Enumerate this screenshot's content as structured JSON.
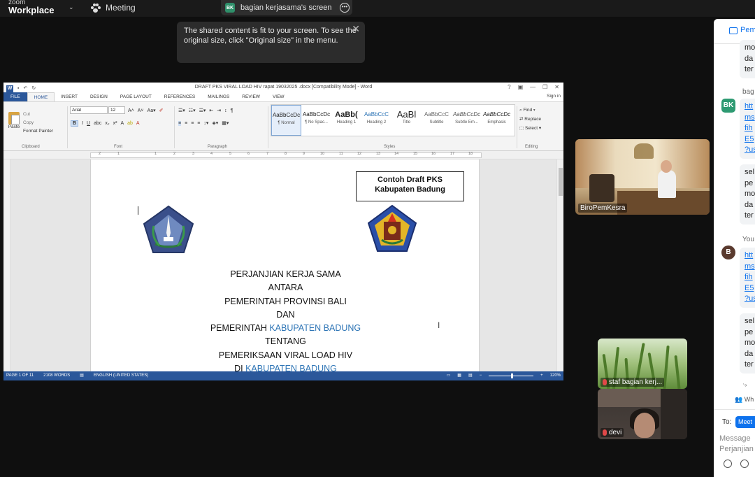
{
  "zoom": {
    "brand_small": "zoom",
    "brand_big": "Workplace",
    "meeting_label": "Meeting",
    "share_initials": "BK",
    "share_title": "bagian kerjasama's screen",
    "tooltip": "The shared content is fit to your screen. To see the original size, click \"Original size\" in the menu."
  },
  "word": {
    "title": "DRAFT PKS VIRAL LOAD HIV rapat 19032025 .docx [Compatibility Mode] - Word",
    "tabs": [
      "FILE",
      "HOME",
      "INSERT",
      "DESIGN",
      "PAGE LAYOUT",
      "REFERENCES",
      "MAILINGS",
      "REVIEW",
      "VIEW"
    ],
    "sign_in": "Sign in",
    "clipboard": {
      "paste": "Paste",
      "cut": "Cut",
      "copy": "Copy",
      "format_painter": "Format Painter",
      "label": "Clipboard"
    },
    "font": {
      "name": "Arial",
      "size": "12",
      "label": "Font"
    },
    "paragraph_label": "Paragraph",
    "styles": [
      {
        "preview": "AaBbCcDc",
        "name": "¶ Normal"
      },
      {
        "preview": "AaBbCcDc",
        "name": "¶ No Spac..."
      },
      {
        "preview": "AaBb(",
        "name": "Heading 1"
      },
      {
        "preview": "AaBbCcC",
        "name": "Heading 2"
      },
      {
        "preview": "AaBl",
        "name": "Title"
      },
      {
        "preview": "AaBbCcC",
        "name": "Subtitle"
      },
      {
        "preview": "AaBbCcDc",
        "name": "Subtle Em..."
      },
      {
        "preview": "AaBbCcDc",
        "name": "Emphasis"
      }
    ],
    "styles_label": "Styles",
    "editing": {
      "find": "Find",
      "replace": "Replace",
      "select": "Select",
      "label": "Editing"
    },
    "document": {
      "box_line1": "Contoh Draft PKS",
      "box_line2": "Kabupaten Badung",
      "lines": [
        {
          "text": "PERJANJIAN KERJA SAMA"
        },
        {
          "text": "ANTARA"
        },
        {
          "text": "PEMERINTAH PROVINSI BALI"
        },
        {
          "text": "DAN"
        },
        {
          "text": "PEMERINTAH ",
          "highlight": "KABUPATEN BADUNG"
        },
        {
          "text": "TENTANG"
        },
        {
          "text": "PEMERIKSAAN VIRAL LOAD HIV"
        },
        {
          "text": "DI ",
          "highlight": "KABUPATEN BADUNG"
        }
      ]
    },
    "status": {
      "page": "PAGE 1 OF 11",
      "words": "2108 WORDS",
      "language": "ENGLISH (UNITED STATES)",
      "zoom": "120%"
    }
  },
  "participants": [
    {
      "name": "BiroPemKesra"
    },
    {
      "name": "staf bagian kerj..."
    },
    {
      "name": "devi"
    }
  ],
  "chat": {
    "header": "Pem",
    "messages": [
      {
        "lines": [
          "mo",
          "da",
          "ter"
        ]
      },
      {
        "sender": "bag",
        "initials": "BK",
        "lines": [
          "htt",
          "ms",
          "fih",
          "E5",
          "?us"
        ],
        "link": true
      },
      {
        "lines": [
          "sel",
          "pe",
          "mo",
          "da",
          "ter"
        ]
      },
      {
        "sender": "You",
        "initials": "B",
        "lines": [
          "htt",
          "ms",
          "fih",
          "E5",
          "?us"
        ],
        "link": true
      },
      {
        "lines": [
          "sel",
          "pe",
          "mo",
          "da",
          "ter"
        ]
      }
    ],
    "who_can_see": "Wh",
    "to_label": "To:",
    "to_value": "Meet",
    "placeholder_line1": "Message",
    "placeholder_line2": "Perjanjian"
  }
}
